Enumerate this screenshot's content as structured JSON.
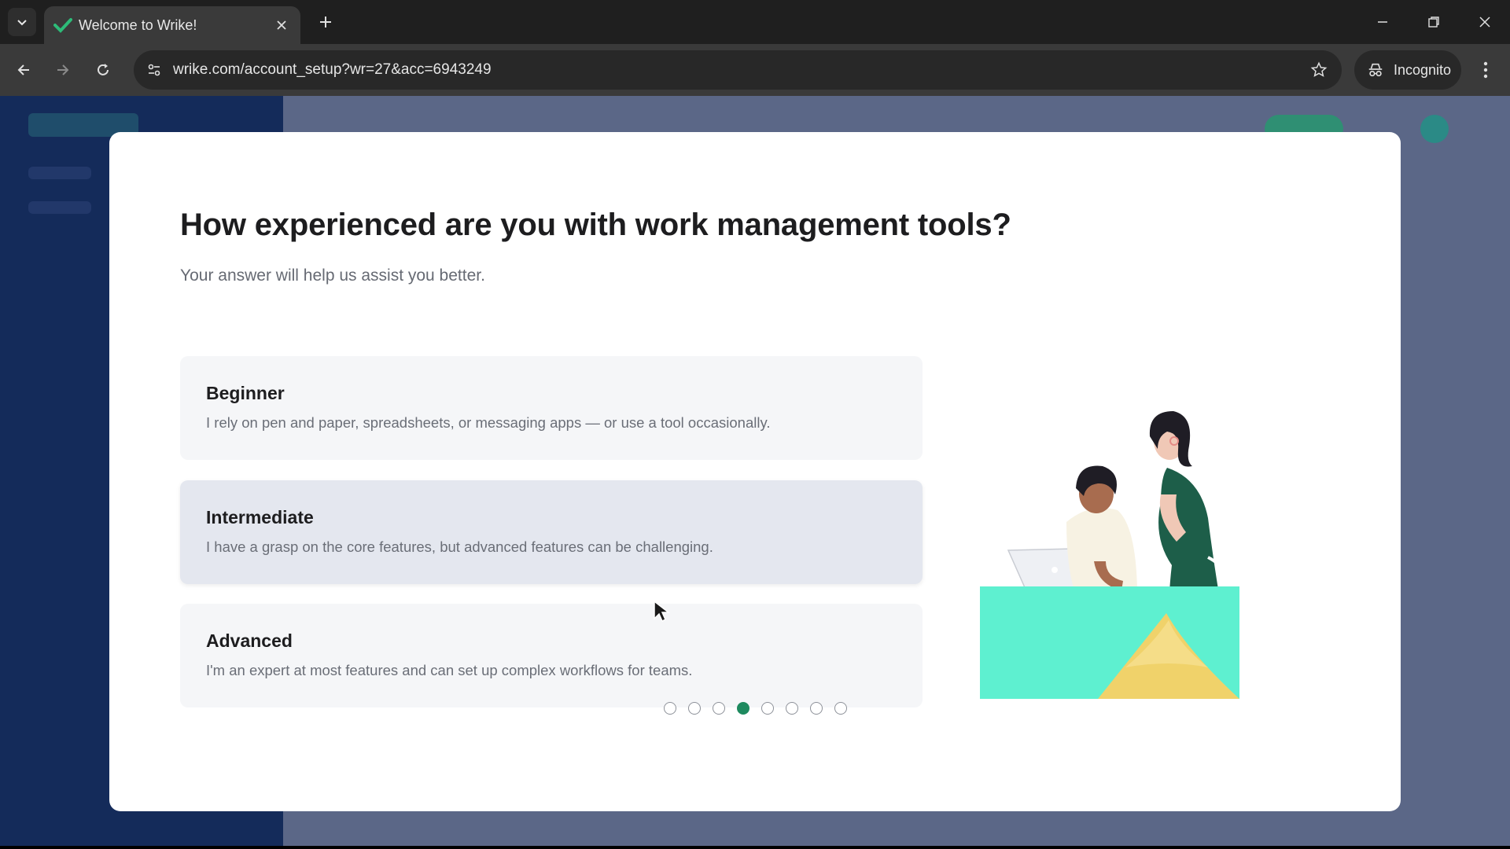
{
  "browser": {
    "tab": {
      "title": "Welcome to Wrike!"
    },
    "address_bar": {
      "url": "wrike.com/account_setup?wr=27&acc=6943249"
    },
    "profile": {
      "label": "Incognito"
    }
  },
  "onboarding": {
    "heading": "How experienced are you with work management tools?",
    "subtitle": "Your answer will help us assist you better.",
    "options": [
      {
        "title": "Beginner",
        "description": "I rely on pen and paper, spreadsheets, or messaging apps — or use a tool occasionally."
      },
      {
        "title": "Intermediate",
        "description": "I have a grasp on the core features, but advanced features can be challenging."
      },
      {
        "title": "Advanced",
        "description": "I'm an expert at most features and can set up complex workflows for teams."
      }
    ],
    "pagination": {
      "total": 8,
      "current": 4
    }
  },
  "colors": {
    "accent": "#1e8a5f",
    "modal_bg": "#ffffff",
    "overlay": "#5b6787"
  }
}
